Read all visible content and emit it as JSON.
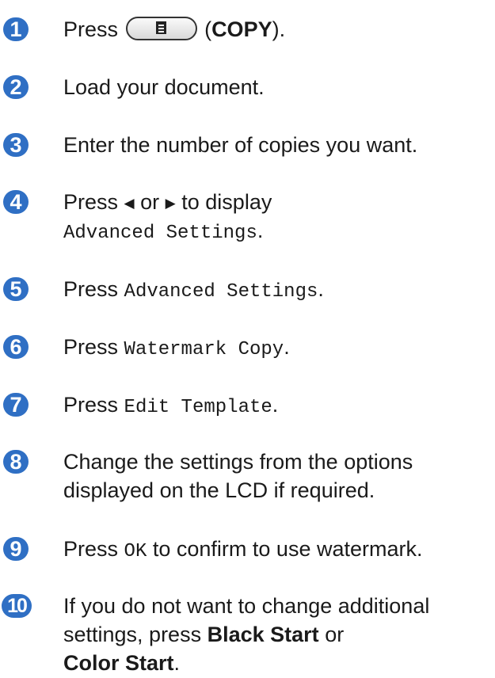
{
  "steps": [
    {
      "n": "1",
      "press": "Press",
      "copy_label": "COPY",
      "paren_open": "(",
      "paren_close": ")."
    },
    {
      "n": "2",
      "text": "Load your document."
    },
    {
      "n": "3",
      "text": "Enter the number of copies you want."
    },
    {
      "n": "4",
      "press": "Press",
      "left_arrow": "◀",
      "or": "or",
      "right_arrow": "▶",
      "to_display": "to display",
      "menu": "Advanced Settings",
      "end": "."
    },
    {
      "n": "5",
      "press": "Press",
      "menu": "Advanced Settings",
      "end": "."
    },
    {
      "n": "6",
      "press": "Press",
      "menu": "Watermark Copy",
      "end": "."
    },
    {
      "n": "7",
      "press": "Press",
      "menu": "Edit Template",
      "end": "."
    },
    {
      "n": "8",
      "line1": "Change the settings from the options",
      "line2": "displayed on the LCD if required."
    },
    {
      "n": "9",
      "press": "Press",
      "menu": "OK",
      "rest": "to confirm to use watermark."
    },
    {
      "n": "10",
      "line1": "If you do not want to change additional",
      "line2_pre": "settings, press",
      "black_start": "Black Start",
      "or": "or",
      "color_start": "Color Start",
      "end": "."
    }
  ],
  "icons": {
    "copy_button": "copy-document-icon"
  },
  "colors": {
    "step_badge": "#2f6fc4",
    "text": "#1a1a1a"
  }
}
